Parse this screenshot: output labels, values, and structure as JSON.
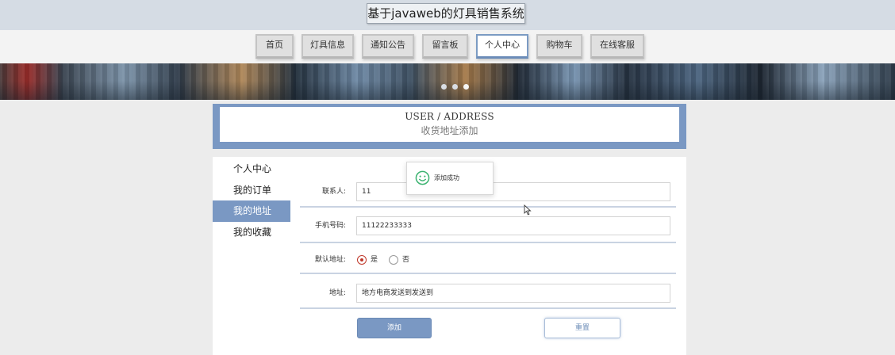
{
  "header": {
    "site_title": "基于javaweb的灯具销售系统"
  },
  "nav": {
    "items": [
      {
        "label": "首页"
      },
      {
        "label": "灯具信息"
      },
      {
        "label": "通知公告"
      },
      {
        "label": "留言板"
      },
      {
        "label": "个人中心",
        "active": true
      },
      {
        "label": "购物车"
      },
      {
        "label": "在线客服"
      }
    ]
  },
  "page_title": {
    "en": "USER / ADDRESS",
    "cn": "收货地址添加"
  },
  "sidebar": {
    "items": [
      {
        "label": "个人中心"
      },
      {
        "label": "我的订单"
      },
      {
        "label": "我的地址",
        "active": true
      },
      {
        "label": "我的收藏"
      }
    ]
  },
  "form": {
    "contact": {
      "label": "联系人:",
      "value": "11"
    },
    "phone": {
      "label": "手机号码:",
      "value": "11122233333"
    },
    "default_address": {
      "label": "默认地址:",
      "options": [
        "是",
        "否"
      ],
      "selected": "是"
    },
    "address": {
      "label": "地址:",
      "value": "地方电商发送到发送到"
    },
    "submit_label": "添加",
    "reset_label": "重置"
  },
  "toast": {
    "message": "添加成功",
    "icon": "smile-icon"
  },
  "colors": {
    "accent": "#7a98c3",
    "radio": "#c0392b",
    "success": "#3cb371"
  }
}
